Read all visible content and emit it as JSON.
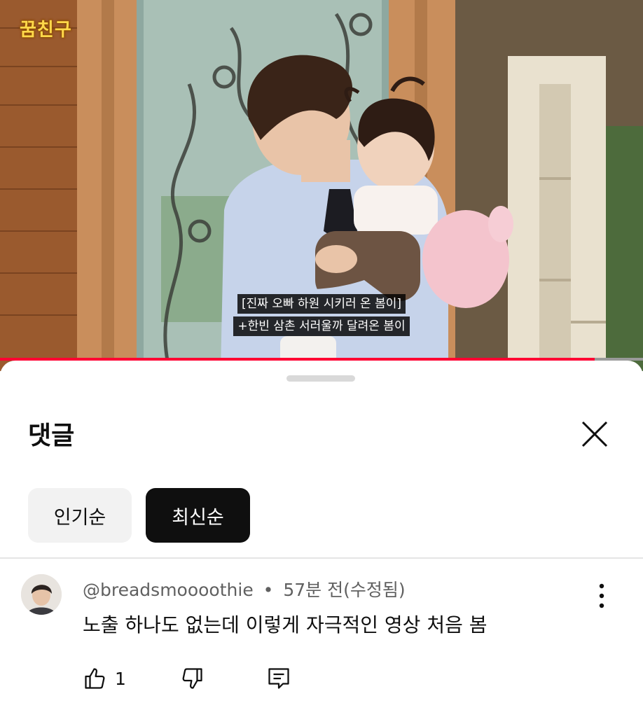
{
  "video": {
    "channel_logo": "꿈친구",
    "subtitle_line1": "[진짜 오빠 하원 시키러 온 봄이]",
    "subtitle_line2": "+한빈 삼촌 서러울까 달려온 봄이",
    "progress": 0.925,
    "progress_color": "#ff0033"
  },
  "comments_panel": {
    "title": "댓글",
    "close_icon": "close-icon",
    "sort_chips": [
      {
        "label": "인기순",
        "selected": false
      },
      {
        "label": "최신순",
        "selected": true
      }
    ],
    "comments": [
      {
        "author": "@breadsmoooothie",
        "separator": "•",
        "time": "57분 전(수정됨)",
        "text": "노출 하나도 없는데 이렇게 자극적인 영상 처음 봄",
        "like_count": "1",
        "icons": [
          "thumbs-up-icon",
          "thumbs-down-icon",
          "reply-icon",
          "more-vert-icon"
        ]
      }
    ]
  }
}
